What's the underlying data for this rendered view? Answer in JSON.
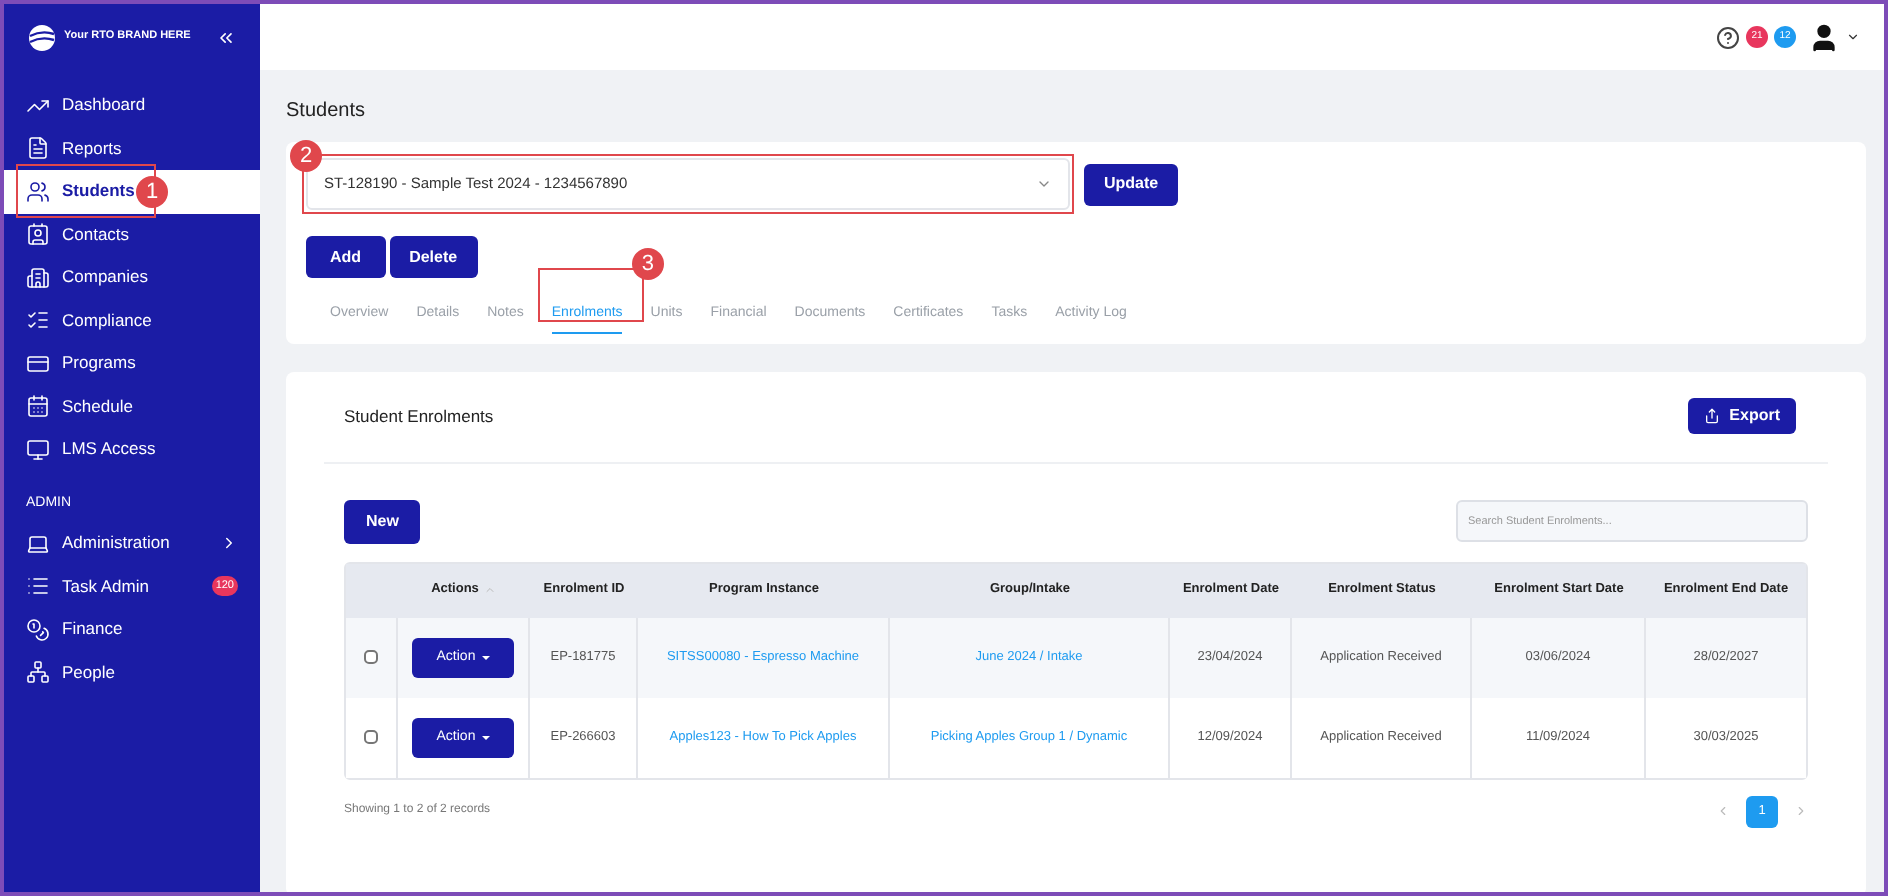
{
  "brand": {
    "name": "Your RTO BRAND HERE"
  },
  "sidebar": {
    "items": [
      {
        "label": "Dashboard",
        "selected": false
      },
      {
        "label": "Reports",
        "selected": false
      },
      {
        "label": "Students",
        "selected": true,
        "callout": "1"
      },
      {
        "label": "Contacts",
        "selected": false
      },
      {
        "label": "Companies",
        "selected": false
      },
      {
        "label": "Compliance",
        "selected": false
      },
      {
        "label": "Programs",
        "selected": false
      },
      {
        "label": "Schedule",
        "selected": false
      },
      {
        "label": "LMS Access",
        "selected": false
      }
    ],
    "section": "ADMIN",
    "admin_items": [
      {
        "label": "Administration",
        "selected": false,
        "expandable": true
      },
      {
        "label": "Task Admin",
        "selected": false,
        "badge": "120"
      },
      {
        "label": "Finance",
        "selected": false
      },
      {
        "label": "People",
        "selected": false
      }
    ]
  },
  "topbar": {
    "badges": [
      {
        "count": "21",
        "color": "#e8365d"
      },
      {
        "count": "12",
        "color": "#1e9bf0"
      }
    ]
  },
  "page_title": "Students",
  "student_select": {
    "value": "ST-128190 - Sample Test 2024 - 1234567890",
    "callout": "2"
  },
  "buttons": {
    "update": "Update",
    "add": "Add",
    "delete": "Delete",
    "new": "New",
    "export": "Export"
  },
  "tabs": [
    {
      "label": "Overview",
      "selected": false
    },
    {
      "label": "Details",
      "selected": false
    },
    {
      "label": "Notes",
      "selected": false
    },
    {
      "label": "Enrolments",
      "selected": true,
      "callout": "3"
    },
    {
      "label": "Units",
      "selected": false
    },
    {
      "label": "Financial",
      "selected": false
    },
    {
      "label": "Documents",
      "selected": false
    },
    {
      "label": "Certificates",
      "selected": false
    },
    {
      "label": "Tasks",
      "selected": false
    },
    {
      "label": "Activity Log",
      "selected": false
    }
  ],
  "enrolments": {
    "title": "Student Enrolments",
    "search": {
      "placeholder": "Search Student Enrolments..."
    },
    "table": {
      "columns": [
        "Actions",
        "Enrolment ID",
        "Program Instance",
        "Group/Intake",
        "Enrolment Date",
        "Enrolment Status",
        "Enrolment Start Date",
        "Enrolment End Date"
      ],
      "rows": [
        {
          "checked": false,
          "action": "Action",
          "id": "EP-181775",
          "program": "SITSS00080 - Espresso Machine",
          "group": "June 2024 / Intake",
          "date": "23/04/2024",
          "status": "Application Received",
          "start": "03/06/2024",
          "end": "28/02/2027"
        },
        {
          "checked": false,
          "action": "Action",
          "id": "EP-266603",
          "program": "Apples123 - How To Pick Apples",
          "group": "Picking Apples Group 1 / Dynamic",
          "date": "12/09/2024",
          "status": "Application Received",
          "start": "11/09/2024",
          "end": "30/03/2025"
        }
      ]
    },
    "footer": "Showing 1 to 2 of 2 records",
    "pages": [
      {
        "label": "1",
        "selected": true
      }
    ]
  }
}
